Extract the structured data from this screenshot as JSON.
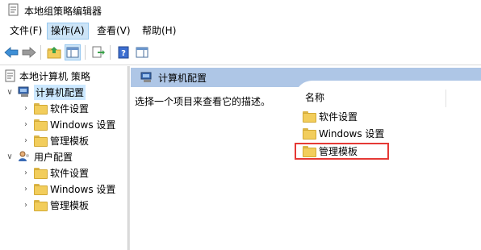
{
  "window": {
    "title": "本地组策略编辑器"
  },
  "menubar": {
    "items": [
      {
        "label": "文件(F)",
        "active": false
      },
      {
        "label": "操作(A)",
        "active": true
      },
      {
        "label": "查看(V)",
        "active": false
      },
      {
        "label": "帮助(H)",
        "active": false
      }
    ]
  },
  "toolbar": {
    "buttons": [
      "back-arrow-icon",
      "forward-arrow-icon",
      "up-folder-icon",
      "show-hide-tree-icon",
      "export-list-icon",
      "help-icon",
      "properties-pane-icon"
    ]
  },
  "tree": {
    "root": "本地计算机 策略",
    "computer_config": {
      "label": "计算机配置",
      "children": [
        "软件设置",
        "Windows 设置",
        "管理模板"
      ]
    },
    "user_config": {
      "label": "用户配置",
      "children": [
        "软件设置",
        "Windows 设置",
        "管理模板"
      ]
    }
  },
  "right": {
    "header": "计算机配置",
    "description": "选择一个项目来查看它的描述。",
    "column_name": "名称",
    "items": [
      "软件设置",
      "Windows 设置",
      "管理模板"
    ],
    "highlighted_item": "管理模板"
  },
  "colors": {
    "header_bg": "#aec6e6",
    "selection_bg": "#cce8ff",
    "highlight_border": "#e53935",
    "folder_yellow": "#f2cd5c"
  }
}
